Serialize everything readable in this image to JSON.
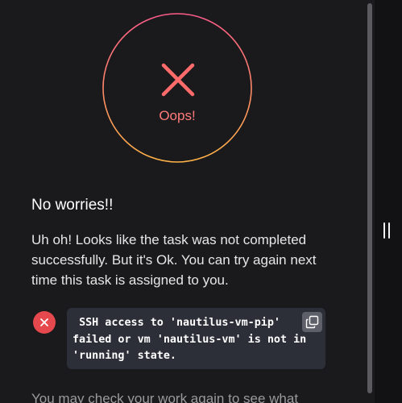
{
  "result": {
    "status_text": "Oops!",
    "heading": "No worries!!",
    "message": "Uh oh! Looks like the task was not completed successfully. But it's Ok. You can try again next time this task is assigned to you.",
    "error": {
      "code_text": " SSH access to 'nautilus-vm-pip' failed or vm 'nautilus-vm' is not in 'running' state."
    },
    "footer_text": "You may check your work again to see what"
  },
  "colors": {
    "background": "#1a1a1c",
    "ring_start": "#ff5c8a",
    "ring_end": "#ffb347",
    "error_red": "#e5484d",
    "code_bg": "#2c2f38"
  },
  "icons": {
    "status": "close-icon",
    "error": "error-icon",
    "copy": "copy-icon"
  }
}
